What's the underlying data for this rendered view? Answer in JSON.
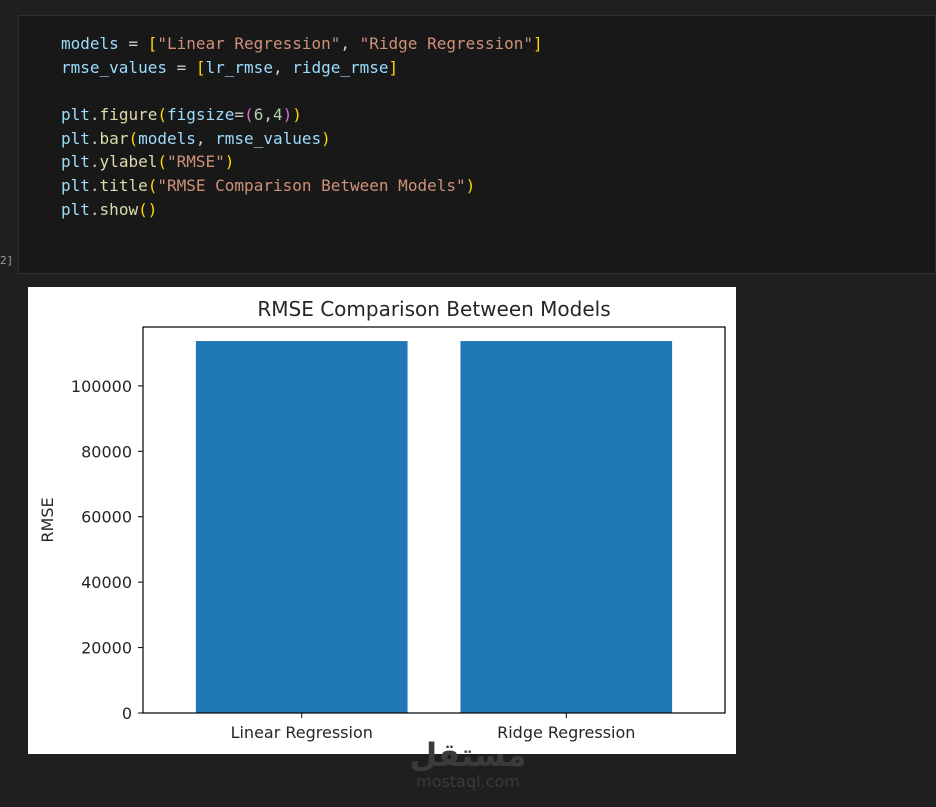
{
  "cell": {
    "execution_label": "2]",
    "code_lines": [
      [
        {
          "t": "models",
          "c": "v"
        },
        {
          "t": " = "
        },
        {
          "t": "[",
          "c": "b1"
        },
        {
          "t": "\"Linear Regression\"",
          "c": "s"
        },
        {
          "t": ", "
        },
        {
          "t": "\"Ridge Regression\"",
          "c": "s"
        },
        {
          "t": "]",
          "c": "b1"
        }
      ],
      [
        {
          "t": "rmse_values",
          "c": "v"
        },
        {
          "t": " = "
        },
        {
          "t": "[",
          "c": "b1"
        },
        {
          "t": "lr_rmse",
          "c": "v"
        },
        {
          "t": ", "
        },
        {
          "t": "ridge_rmse",
          "c": "v"
        },
        {
          "t": "]",
          "c": "b1"
        }
      ],
      [],
      [
        {
          "t": "plt",
          "c": "v"
        },
        {
          "t": "."
        },
        {
          "t": "figure",
          "c": "f"
        },
        {
          "t": "(",
          "c": "b1"
        },
        {
          "t": "figsize",
          "c": "v"
        },
        {
          "t": "="
        },
        {
          "t": "(",
          "c": "b2"
        },
        {
          "t": "6",
          "c": "n"
        },
        {
          "t": ","
        },
        {
          "t": "4",
          "c": "n"
        },
        {
          "t": ")",
          "c": "b2"
        },
        {
          "t": ")",
          "c": "b1"
        }
      ],
      [
        {
          "t": "plt",
          "c": "v"
        },
        {
          "t": "."
        },
        {
          "t": "bar",
          "c": "f"
        },
        {
          "t": "(",
          "c": "b1"
        },
        {
          "t": "models",
          "c": "v"
        },
        {
          "t": ", "
        },
        {
          "t": "rmse_values",
          "c": "v"
        },
        {
          "t": ")",
          "c": "b1"
        }
      ],
      [
        {
          "t": "plt",
          "c": "v"
        },
        {
          "t": "."
        },
        {
          "t": "ylabel",
          "c": "f"
        },
        {
          "t": "(",
          "c": "b1"
        },
        {
          "t": "\"RMSE\"",
          "c": "s"
        },
        {
          "t": ")",
          "c": "b1"
        }
      ],
      [
        {
          "t": "plt",
          "c": "v"
        },
        {
          "t": "."
        },
        {
          "t": "title",
          "c": "f"
        },
        {
          "t": "(",
          "c": "b1"
        },
        {
          "t": "\"RMSE Comparison Between Models\"",
          "c": "s"
        },
        {
          "t": ")",
          "c": "b1"
        }
      ],
      [
        {
          "t": "plt",
          "c": "v"
        },
        {
          "t": "."
        },
        {
          "t": "show",
          "c": "f"
        },
        {
          "t": "(",
          "c": "b1"
        },
        {
          "t": ")",
          "c": "b1"
        }
      ]
    ]
  },
  "chart_data": {
    "type": "bar",
    "title": "RMSE Comparison Between Models",
    "xlabel": "",
    "ylabel": "RMSE",
    "categories": [
      "Linear Regression",
      "Ridge Regression"
    ],
    "values": [
      113700,
      113700
    ],
    "ylim": [
      0,
      118000
    ],
    "yticks": [
      0,
      20000,
      40000,
      60000,
      80000,
      100000
    ],
    "ytick_labels": [
      "0",
      "20000",
      "40000",
      "60000",
      "80000",
      "100000"
    ],
    "bar_color": "#1f77b4",
    "grid": false
  },
  "watermark": {
    "arabic": "مستقل",
    "latin": "mostaql.com"
  }
}
